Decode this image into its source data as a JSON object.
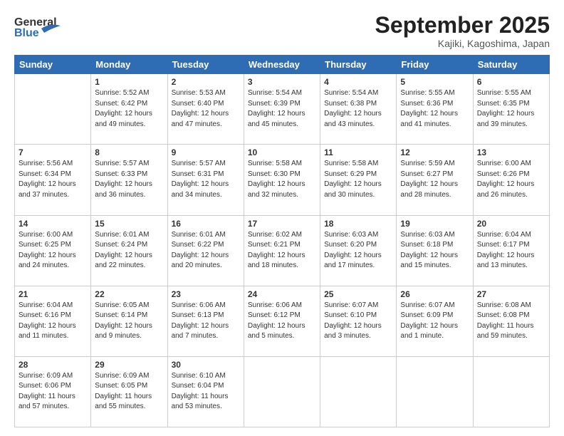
{
  "header": {
    "logo_line1": "General",
    "logo_line2": "Blue",
    "month_title": "September 2025",
    "location": "Kajiki, Kagoshima, Japan"
  },
  "weekdays": [
    "Sunday",
    "Monday",
    "Tuesday",
    "Wednesday",
    "Thursday",
    "Friday",
    "Saturday"
  ],
  "weeks": [
    [
      {
        "day": "",
        "info": ""
      },
      {
        "day": "1",
        "info": "Sunrise: 5:52 AM\nSunset: 6:42 PM\nDaylight: 12 hours\nand 49 minutes."
      },
      {
        "day": "2",
        "info": "Sunrise: 5:53 AM\nSunset: 6:40 PM\nDaylight: 12 hours\nand 47 minutes."
      },
      {
        "day": "3",
        "info": "Sunrise: 5:54 AM\nSunset: 6:39 PM\nDaylight: 12 hours\nand 45 minutes."
      },
      {
        "day": "4",
        "info": "Sunrise: 5:54 AM\nSunset: 6:38 PM\nDaylight: 12 hours\nand 43 minutes."
      },
      {
        "day": "5",
        "info": "Sunrise: 5:55 AM\nSunset: 6:36 PM\nDaylight: 12 hours\nand 41 minutes."
      },
      {
        "day": "6",
        "info": "Sunrise: 5:55 AM\nSunset: 6:35 PM\nDaylight: 12 hours\nand 39 minutes."
      }
    ],
    [
      {
        "day": "7",
        "info": "Sunrise: 5:56 AM\nSunset: 6:34 PM\nDaylight: 12 hours\nand 37 minutes."
      },
      {
        "day": "8",
        "info": "Sunrise: 5:57 AM\nSunset: 6:33 PM\nDaylight: 12 hours\nand 36 minutes."
      },
      {
        "day": "9",
        "info": "Sunrise: 5:57 AM\nSunset: 6:31 PM\nDaylight: 12 hours\nand 34 minutes."
      },
      {
        "day": "10",
        "info": "Sunrise: 5:58 AM\nSunset: 6:30 PM\nDaylight: 12 hours\nand 32 minutes."
      },
      {
        "day": "11",
        "info": "Sunrise: 5:58 AM\nSunset: 6:29 PM\nDaylight: 12 hours\nand 30 minutes."
      },
      {
        "day": "12",
        "info": "Sunrise: 5:59 AM\nSunset: 6:27 PM\nDaylight: 12 hours\nand 28 minutes."
      },
      {
        "day": "13",
        "info": "Sunrise: 6:00 AM\nSunset: 6:26 PM\nDaylight: 12 hours\nand 26 minutes."
      }
    ],
    [
      {
        "day": "14",
        "info": "Sunrise: 6:00 AM\nSunset: 6:25 PM\nDaylight: 12 hours\nand 24 minutes."
      },
      {
        "day": "15",
        "info": "Sunrise: 6:01 AM\nSunset: 6:24 PM\nDaylight: 12 hours\nand 22 minutes."
      },
      {
        "day": "16",
        "info": "Sunrise: 6:01 AM\nSunset: 6:22 PM\nDaylight: 12 hours\nand 20 minutes."
      },
      {
        "day": "17",
        "info": "Sunrise: 6:02 AM\nSunset: 6:21 PM\nDaylight: 12 hours\nand 18 minutes."
      },
      {
        "day": "18",
        "info": "Sunrise: 6:03 AM\nSunset: 6:20 PM\nDaylight: 12 hours\nand 17 minutes."
      },
      {
        "day": "19",
        "info": "Sunrise: 6:03 AM\nSunset: 6:18 PM\nDaylight: 12 hours\nand 15 minutes."
      },
      {
        "day": "20",
        "info": "Sunrise: 6:04 AM\nSunset: 6:17 PM\nDaylight: 12 hours\nand 13 minutes."
      }
    ],
    [
      {
        "day": "21",
        "info": "Sunrise: 6:04 AM\nSunset: 6:16 PM\nDaylight: 12 hours\nand 11 minutes."
      },
      {
        "day": "22",
        "info": "Sunrise: 6:05 AM\nSunset: 6:14 PM\nDaylight: 12 hours\nand 9 minutes."
      },
      {
        "day": "23",
        "info": "Sunrise: 6:06 AM\nSunset: 6:13 PM\nDaylight: 12 hours\nand 7 minutes."
      },
      {
        "day": "24",
        "info": "Sunrise: 6:06 AM\nSunset: 6:12 PM\nDaylight: 12 hours\nand 5 minutes."
      },
      {
        "day": "25",
        "info": "Sunrise: 6:07 AM\nSunset: 6:10 PM\nDaylight: 12 hours\nand 3 minutes."
      },
      {
        "day": "26",
        "info": "Sunrise: 6:07 AM\nSunset: 6:09 PM\nDaylight: 12 hours\nand 1 minute."
      },
      {
        "day": "27",
        "info": "Sunrise: 6:08 AM\nSunset: 6:08 PM\nDaylight: 11 hours\nand 59 minutes."
      }
    ],
    [
      {
        "day": "28",
        "info": "Sunrise: 6:09 AM\nSunset: 6:06 PM\nDaylight: 11 hours\nand 57 minutes."
      },
      {
        "day": "29",
        "info": "Sunrise: 6:09 AM\nSunset: 6:05 PM\nDaylight: 11 hours\nand 55 minutes."
      },
      {
        "day": "30",
        "info": "Sunrise: 6:10 AM\nSunset: 6:04 PM\nDaylight: 11 hours\nand 53 minutes."
      },
      {
        "day": "",
        "info": ""
      },
      {
        "day": "",
        "info": ""
      },
      {
        "day": "",
        "info": ""
      },
      {
        "day": "",
        "info": ""
      }
    ]
  ]
}
